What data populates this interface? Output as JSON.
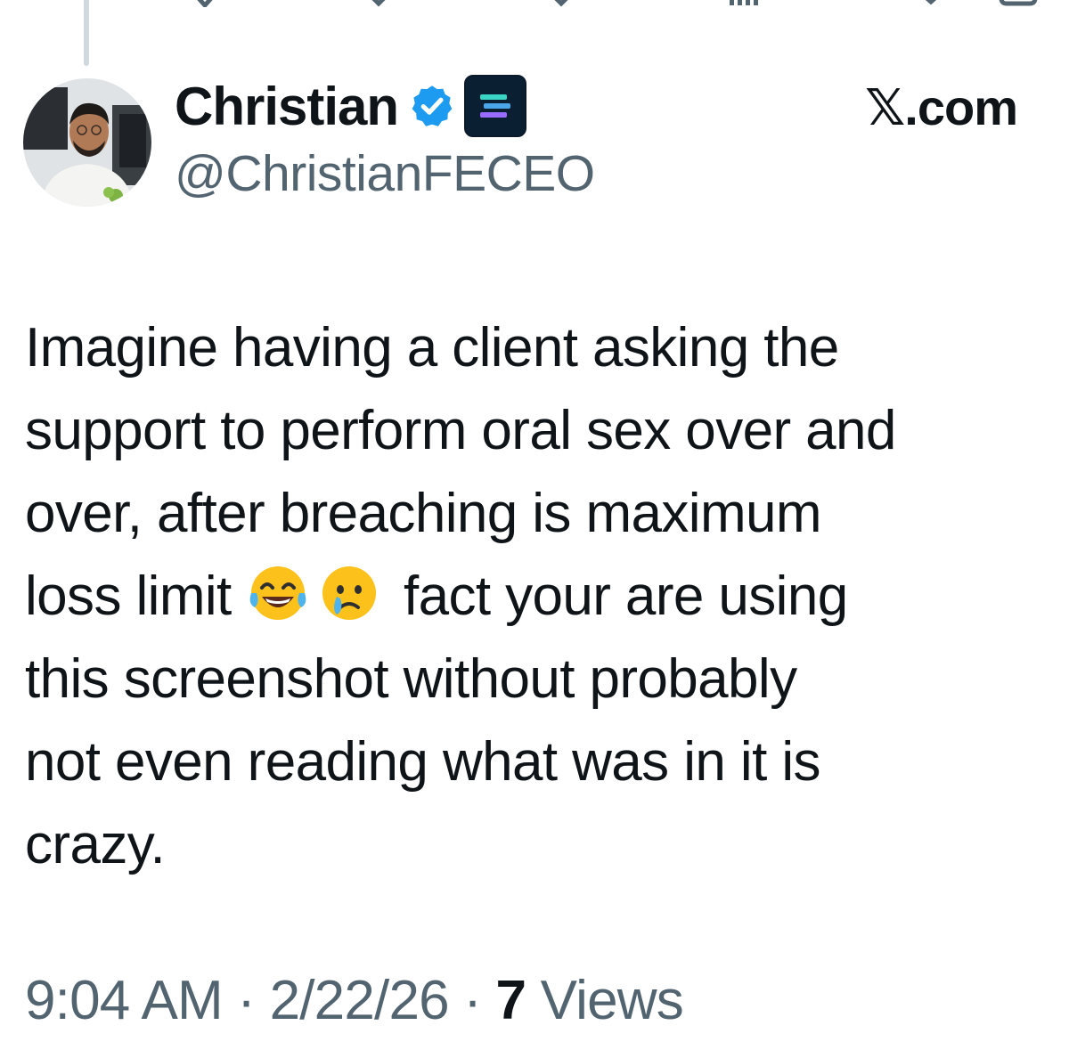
{
  "author": {
    "display_name": "Christian",
    "handle": "@ChristianFECEO",
    "verified": true,
    "verified_color": "#1d9bf0"
  },
  "site_label": "𝕏.com",
  "tweet": {
    "lines": [
      "Imagine having a client asking the",
      "support to perform oral sex over and",
      "over, after breaching is maximum"
    ],
    "line4_prefix": "loss limit ",
    "line4_suffix": " fact your are using",
    "lines_after": [
      "this screenshot without probably",
      "not even reading what was in it is",
      "crazy."
    ],
    "emojis": [
      "tears-of-joy-emoji",
      "crying-face-emoji"
    ]
  },
  "meta": {
    "time": "9:04 AM",
    "separator": " · ",
    "date": "2/22/26",
    "view_count": "7",
    "views_label": " Views"
  },
  "colors": {
    "text_primary": "#0f1419",
    "text_secondary": "#536471",
    "accent": "#1d9bf0"
  }
}
